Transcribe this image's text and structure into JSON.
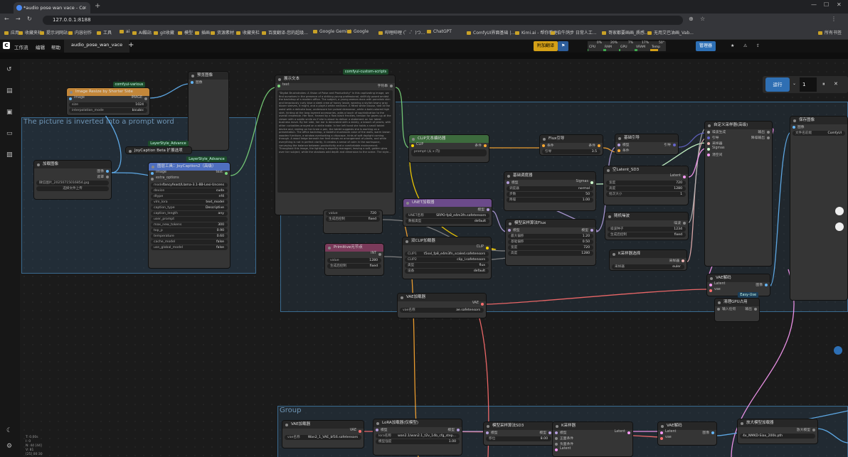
{
  "browser": {
    "tab_title": "*audio pose wan vace - Co",
    "url": "127.0.0.1:8188",
    "bookmarks": [
      "应用",
      "收藏夹栏",
      "提示词网站",
      "内容创作",
      "工具",
      "ai",
      "AI酷站",
      "git收藏",
      "模型",
      "插画",
      "资源素材",
      "收藏夹栏",
      "百度翻译-您的超级...",
      "Google Gemini",
      "Google",
      "哔哩哔哩 (゜-゜)つ...",
      "ChatGPT",
      "ComfyUI界面基础 |...",
      "Kimi.ai - 帮你看更...",
      "伯牛鸽步 日常人工...",
      "哥家都要画画_质感...",
      "无用艾巴油画_Vab...",
      "所有书签"
    ]
  },
  "app": {
    "menu": [
      "工作流",
      "编辑",
      "帮助"
    ],
    "workflow_tab": "audio_pose_wan_vace",
    "toolbar_buttons": [
      "附加翻译",
      "管理器"
    ],
    "meters": [
      {
        "label": "CPU",
        "value": "0%",
        "fraction": 0.0
      },
      {
        "label": "RAM",
        "value": "20%",
        "fraction": 0.2
      },
      {
        "label": "GPU",
        "value": "7%",
        "fraction": 0.07
      },
      {
        "label": "VRAM",
        "value": "17%",
        "fraction": 0.17
      },
      {
        "label": "Temp",
        "value": "50°",
        "fraction": 0.5
      }
    ],
    "queue": {
      "mode": "运行",
      "count": "1"
    }
  },
  "groups": [
    {
      "title": "The picture is inverted into a prompt word"
    },
    {
      "title": ""
    },
    {
      "title": "Group"
    }
  ],
  "nodes": {
    "resize": {
      "title": "Image Resize by Shorter Side",
      "badge": "comfyui-various",
      "in": "image",
      "out": "IMAGE",
      "widgets": [
        [
          "size",
          "1024"
        ],
        [
          "interpolation_mode",
          "bicubic"
        ]
      ]
    },
    "preview": {
      "title": "预览图像",
      "in": "图像"
    },
    "load_image": {
      "title": "加载图像",
      "file": "微信图片_20250715016854.jpg",
      "upload": "选择文件上传",
      "outs": [
        "图像",
        "遮罩"
      ]
    },
    "joy_loader": {
      "title": "JoyCaption Beta 扩展选项",
      "badge": "LayerStyle_Advance"
    },
    "joy": {
      "title": "图层工具：JoyCaption2（高级）",
      "badge": "LayerStyle_Advance",
      "ins": [
        "image",
        "extra_options"
      ],
      "out": "text",
      "widgets": [
        [
          "model",
          "fancyfeast/Llama-3.1-8B-Lexi-Uncens"
        ],
        [
          "device",
          "cuda"
        ],
        [
          "dtype",
          "nf4"
        ],
        [
          "vlm_lora",
          "text_model"
        ],
        [
          "caption_type",
          "Descriptive"
        ],
        [
          "caption_length",
          "any"
        ],
        [
          "user_prompt",
          ""
        ],
        [
          "max_new_tokens",
          "300"
        ],
        [
          "top_p",
          "0.90"
        ],
        [
          "temperature",
          "0.60"
        ],
        [
          "cache_model",
          "false"
        ],
        [
          "use_global_model",
          "false"
        ]
      ]
    },
    "show_text": {
      "title": "展示文本",
      "badge": "comfyui-custom-scripts",
      "in": "text",
      "out": "字符串",
      "text": "\"Digital Brushstrokes: A Vision of Poise and Productivity\"\n\nIn this captivating image, we find ourselves in the presence of a striking young professional, skillfully posed amidst the backdrop of a modern office. The subject, a young woman dons with porcelain skin and tenaciously curly blue a sleek crew of honey lassie, wearing a stylish tawny gray blazer sleeves, it might, and a playful white necklace. A fitted white blouse, tied at the waist with a delicate bow, underscore her poised demeanor, while a bold-colored high skirt, hinting at the long layered accessories, adds a touch of sophistication to the overall ensemble. Her face, framed by a flow black freckles, tension for gazes up at the viewer with a subtle smile as if she is about to deliver a statement on her latest business move.\n\nBy her side, her ear is decorated with a dainty, a brooch of pearls, with other curiosities arrayed on a white table. In her left hand she holds a small tablet device and, resting on her knee a pen, the tablet suggests she is working on a presentation.\n\nThe office backdrop, a tasteful mushroom color of the walls, warm brown wooden furniture, a window overlooking a cityscape, hints of soft daylight coming through. A wood ledge beneath her feet shows an arrangement of plants, and while everything is not in perfect clarity, it creates a sense of calm in the workspace, conveying the balance between productivity and a comfortable environment.\n\nThroughout this image, the lighting is expertly managed, leaving a soft, golden glow over her subject, while the shadows add depth and dimension to the scene. The style..."
    },
    "clip_text": {
      "title": "CLIP文本编码器",
      "ins": [
        "CLIP"
      ],
      "out": "条件",
      "placeholder": "prompt (从 x 内)"
    },
    "flux_guide": {
      "title": "Flux引导",
      "in": "条件",
      "out": "条件",
      "widgets": [
        [
          "引导",
          "3.5"
        ]
      ]
    },
    "basic_guider": {
      "title": "基础引导",
      "ins": [
        "模型",
        "条件"
      ],
      "out": "引导"
    },
    "custom_sampler": {
      "title": "自定义采样器(高级)",
      "ins": [
        "噪波生成",
        "引导",
        "采样器",
        "Sigmas",
        "潜空间"
      ],
      "outs": [
        "输出",
        "降噪输出"
      ]
    },
    "save_image": {
      "title": "保存图像",
      "in": "图像",
      "widgets": [
        [
          "文件名前缀",
          "ComfyUI"
        ]
      ]
    },
    "basic_sched": {
      "title": "基础调度器",
      "in": "模型",
      "out": "Sigmas",
      "widgets": [
        [
          "调度器",
          "normal"
        ],
        [
          "步数",
          "50"
        ],
        [
          "降噪",
          "1.00"
        ]
      ]
    },
    "empty_latent": {
      "title": "空Latent_SD3",
      "out": "Latent",
      "widgets": [
        [
          "宽度",
          "720"
        ],
        [
          "高度",
          "1280"
        ],
        [
          "批次大小",
          "1"
        ]
      ]
    },
    "random_noise": {
      "title": "随机噪波",
      "out": "噪波",
      "widgets": [
        [
          "噪波种子",
          "1234"
        ],
        [
          "生成后控制",
          "fixed"
        ]
      ]
    },
    "ksampler_sel": {
      "title": "K采样器选择",
      "out": "采样器",
      "widgets": [
        [
          "采样器",
          "euler"
        ]
      ]
    },
    "unet": {
      "title": "UNET加载器",
      "out": "模型",
      "widgets": [
        [
          "UNET名称",
          "SRPO-fp8_e4m3fn.safetensors"
        ],
        [
          "数据类型",
          "default"
        ]
      ]
    },
    "model_sample_flux": {
      "title": "模型采样算法Flux",
      "in": "模型",
      "out": "模型",
      "widgets": [
        [
          "最大偏移",
          "1.20"
        ],
        [
          "基础偏移",
          "0.50"
        ],
        [
          "宽度",
          "720"
        ],
        [
          "高度",
          "1280"
        ]
      ]
    },
    "dual_clip": {
      "title": "双CLIP加载器",
      "out": "CLIP",
      "widgets": [
        [
          "CLIP1",
          "t5xxl_fp8_e4m3fn_scaled.safetensors"
        ],
        [
          "CLIP2",
          "clip_l.safetensors"
        ],
        [
          "类型",
          "flux"
        ],
        [
          "设备",
          "default"
        ]
      ]
    },
    "prim_w": {
      "widgets": [
        [
          "value",
          "720"
        ],
        [
          "生成后控制",
          "fixed"
        ]
      ]
    },
    "prim_h": {
      "title": "Primitive元节点",
      "out": "INT",
      "widgets": [
        [
          "value",
          "1280"
        ],
        [
          "生成后控制",
          "fixed"
        ]
      ]
    },
    "vae_loader1": {
      "title": "VAE加载器",
      "out": "VAE",
      "widgets": [
        [
          "vae名称",
          "ae.safetensors"
        ]
      ]
    },
    "vae_decode1": {
      "title": "VAE解码",
      "ins": [
        "Latent",
        "vae"
      ],
      "out": "图像"
    },
    "cleanup": {
      "title": "清理GPU占用",
      "badge": "Easy-Use",
      "in": "输入任何",
      "out": "输出"
    },
    "vae_loader2": {
      "title": "VAE加载器",
      "out": "VAE",
      "widgets": [
        [
          "vae名称",
          "Wan2_1_VAE_bf16.safetensors"
        ]
      ]
    },
    "lora": {
      "title": "LoRA加载器(仅模型)",
      "in": "模型",
      "out": "模型",
      "widgets": [
        [
          "lora名称",
          "wan2.1/wan2.1_t2v_14b_cfg_step..."
        ],
        [
          "模型强度",
          "1.00"
        ]
      ]
    },
    "model_sample_sd3": {
      "title": "模型采样算法SD3",
      "in": "模型",
      "out": "模型",
      "widgets": [
        [
          "移位",
          "8.00"
        ]
      ]
    },
    "ksampler": {
      "title": "K采样器",
      "ins": [
        "模型",
        "正面条件",
        "负面条件",
        "Latent"
      ],
      "out": "Latent"
    },
    "vae_decode2": {
      "title": "VAE解码",
      "ins": [
        "Latent",
        "vae"
      ],
      "out": "图像"
    },
    "upscale_loader": {
      "title": "放大模型加载器",
      "out": "放大模型",
      "widgets": [
        [
          "",
          "4x_NMKD-Siax_200k.pth"
        ]
      ]
    }
  },
  "status_lines": [
    "T: 0.00s",
    "I: 0",
    "N: 44 [44]",
    "V: 81",
    "[25] 00:30"
  ]
}
